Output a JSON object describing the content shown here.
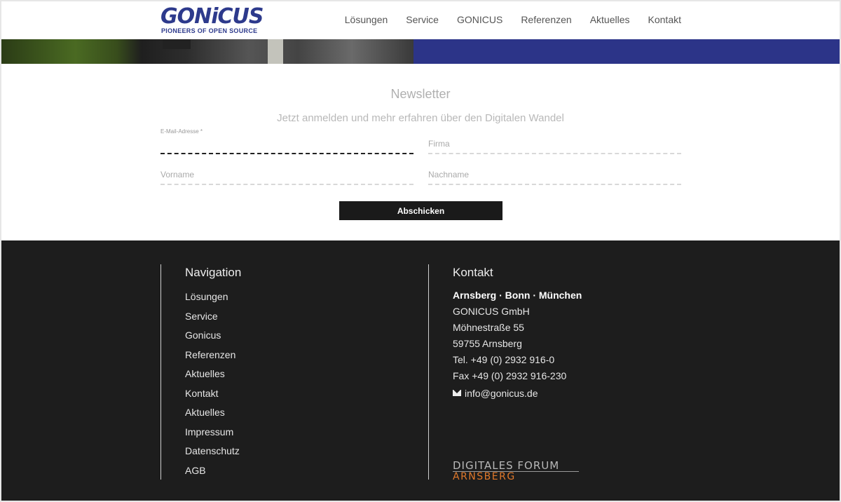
{
  "header": {
    "logo_text": "GONiCUS",
    "logo_tagline": "PIONEERS OF OPEN SOURCE",
    "nav": [
      "Lösungen",
      "Service",
      "GONICUS",
      "Referenzen",
      "Aktuelles",
      "Kontakt"
    ]
  },
  "colors": {
    "brand_blue": "#2c3488",
    "footer_bg": "#1d1d1d",
    "button_bg": "#1a1a1a",
    "accent_orange": "#e0782a"
  },
  "newsletter": {
    "title": "Newsletter",
    "subtitle": "Jetzt anmelden und mehr erfahren über den Digitalen Wandel",
    "email_label": "E-Mail-Adresse *",
    "company_placeholder": "Firma",
    "firstname_placeholder": "Vorname",
    "lastname_placeholder": "Nachname",
    "submit_label": "Abschicken"
  },
  "footer": {
    "nav_heading": "Navigation",
    "nav_links": [
      "Lösungen",
      "Service",
      "Gonicus",
      "Referenzen",
      "Aktuelles",
      "Kontakt",
      "Aktuelles",
      "Impressum",
      "Datenschutz",
      "AGB"
    ],
    "contact_heading": "Kontakt",
    "contact": {
      "locations": "Arnsberg · Bonn · München",
      "company": "GONICUS GmbH",
      "street": "Möhnestraße 55",
      "city": "59755 Arnsberg",
      "tel": "Tel. +49 (0) 2932 916-0",
      "fax": "Fax +49 (0) 2932 916-230",
      "email": "info@gonicus.de"
    },
    "partner_logo": {
      "line1": "DIGITALES FORUM",
      "line2": "ARNSBERG"
    }
  }
}
